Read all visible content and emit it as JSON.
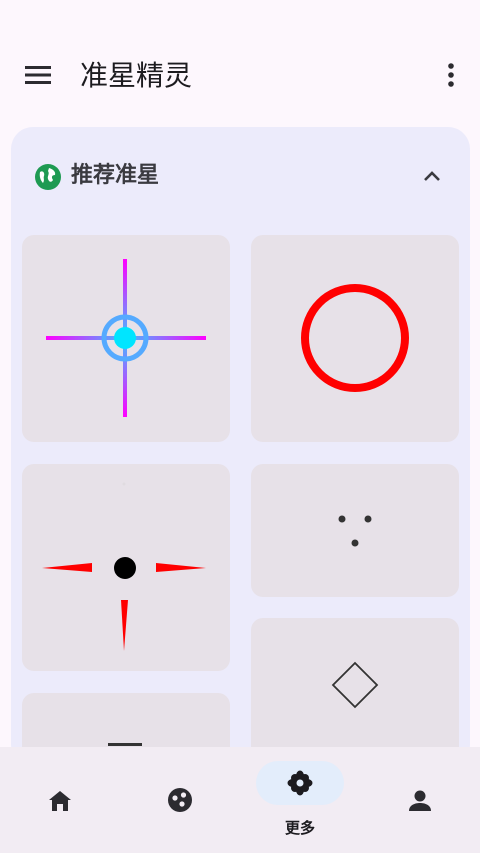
{
  "app": {
    "title": "准星精灵"
  },
  "appbar": {
    "menu_icon": "menu-icon",
    "more_icon": "more-vertical-icon"
  },
  "section": {
    "title": "推荐准星",
    "icon": "globe-icon",
    "toggle_icon": "chevron-up-icon",
    "crosshairs": [
      {
        "name": "crosshair-cyan-circle-cross",
        "colors": [
          "#ff00ff",
          "#55aaff",
          "#00e5ff"
        ]
      },
      {
        "name": "crosshair-red-ring",
        "colors": [
          "#ff0000"
        ]
      },
      {
        "name": "crosshair-red-spikes-dot",
        "colors": [
          "#ff0000",
          "#000000"
        ]
      },
      {
        "name": "crosshair-three-dots",
        "colors": [
          "#333333"
        ]
      },
      {
        "name": "crosshair-diamond",
        "colors": [
          "#333333"
        ]
      },
      {
        "name": "crosshair-partial",
        "colors": [
          "#333333"
        ]
      }
    ]
  },
  "bottom_nav": {
    "items": [
      {
        "icon": "home-icon",
        "label": ""
      },
      {
        "icon": "palette-icon",
        "label": ""
      },
      {
        "icon": "flower-icon",
        "label": "更多",
        "selected": true
      },
      {
        "icon": "person-icon",
        "label": ""
      }
    ]
  },
  "colors": {
    "background": "#fdf7fd",
    "card": "#ecebfb",
    "tile": "#e7e1e8",
    "nav_bar": "#f2ecf3",
    "nav_pill": "#e3edfb",
    "globe": "#1e9a52"
  }
}
